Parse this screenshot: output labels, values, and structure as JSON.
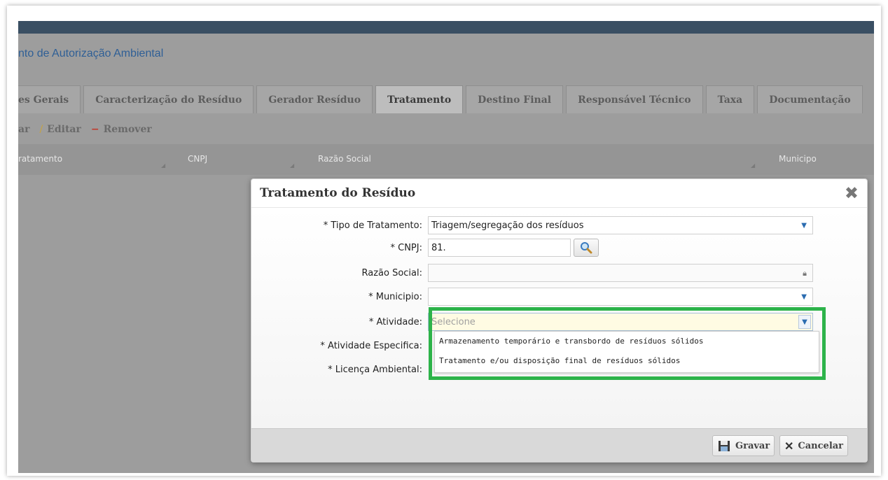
{
  "app": {
    "title": "nto de Autorização Ambiental",
    "tabs": [
      {
        "label": "es Gerais"
      },
      {
        "label": "Caracterização do Resíduo"
      },
      {
        "label": "Gerador Resíduo"
      },
      {
        "label": "Tratamento"
      },
      {
        "label": "Destino Final"
      },
      {
        "label": "Responsável Técnico"
      },
      {
        "label": "Taxa"
      },
      {
        "label": "Documentação"
      }
    ],
    "toolbar": {
      "add_label": "ar",
      "edit_label": "Editar",
      "remove_label": "Remover",
      "edit_icon": "/",
      "remove_icon": "−"
    },
    "grid_columns": [
      "ratamento",
      "CNPJ",
      "Razão Social",
      "Municipo"
    ]
  },
  "dialog": {
    "title": "Tratamento do Resíduo",
    "close_glyph": "✖",
    "fields": {
      "tipo_tratamento": {
        "label": "* Tipo de Tratamento:",
        "value": "Triagem/segregação dos resíduos"
      },
      "cnpj": {
        "label": "* CNPJ:",
        "value": "81."
      },
      "razao_social": {
        "label": "Razão Social:",
        "value": ""
      },
      "municipio": {
        "label": "* Municipio:",
        "value": ""
      },
      "atividade": {
        "label": "* Atividade:",
        "placeholder": "Selecione"
      },
      "atividade_especifica": {
        "label": "* Atividade Especifica:"
      },
      "licenca_ambiental": {
        "label": "* Licença Ambiental:"
      }
    },
    "atividade_options": [
      "Armazenamento temporário e transbordo de resíduos sólidos",
      "Tratamento e/ou disposição final de resíduos sólidos"
    ],
    "buttons": {
      "save_label": "Gravar",
      "cancel_label": "Cancelar",
      "cancel_icon": "✕"
    }
  },
  "colors": {
    "highlight": "#2db34a",
    "link_blue": "#2f5f96",
    "topbar": "#3a4f63"
  },
  "icons": [
    "close-icon",
    "search-icon",
    "lock-icon",
    "chevron-down-icon",
    "save-icon",
    "cancel-icon",
    "pencil-icon",
    "minus-icon"
  ]
}
